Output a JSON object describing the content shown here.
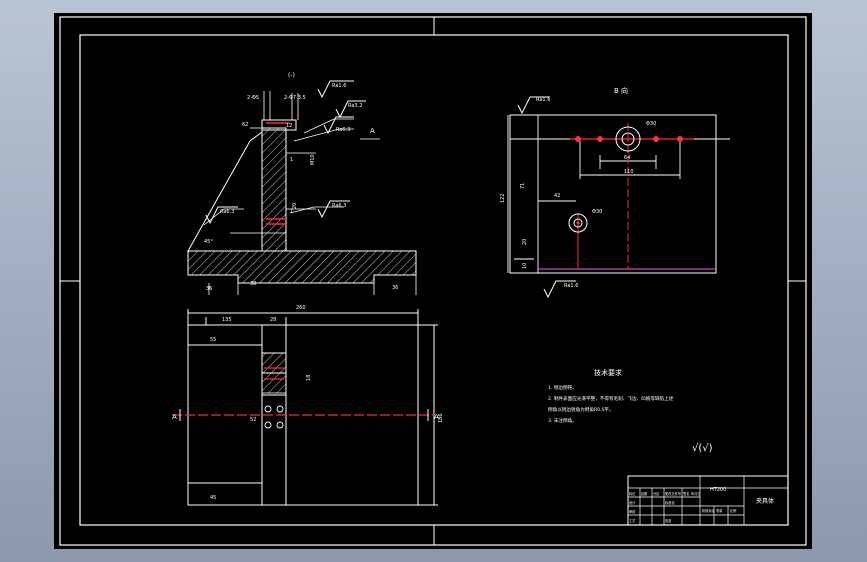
{
  "section_view": {
    "title": "(-)",
    "dims": {
      "left_tab": "2-Φ5",
      "top_chain": "2-Φ7 3.5",
      "h_small": "62",
      "w_small": "12",
      "thread": "M10",
      "dim_1": "1",
      "dim_2": "1",
      "angle": "45°",
      "h_mid": "20",
      "base_left": "36",
      "base_mid": "38",
      "base_right": "36",
      "detail_a": "A"
    },
    "roughness": [
      "Ra1.6",
      "Ra3.2",
      "Ra6.3",
      "Ra6.3",
      "Ra6.3"
    ]
  },
  "top_view": {
    "dims": {
      "overall_w": "260",
      "w1": "135",
      "w2": "28",
      "h1": "55",
      "h2": "45",
      "h_small": "52",
      "h_right": "186",
      "v_small": "18"
    },
    "section_marks": [
      "A",
      "A"
    ]
  },
  "detail_view": {
    "title": "B 向",
    "dims": {
      "left_v": "122",
      "left_v2": "71",
      "inner_v": "20",
      "inner_v2": "10",
      "phi_big": "Φ30",
      "phi_small": "Φ30",
      "span_inner": "64",
      "span_outer": "110",
      "small_off": "42"
    },
    "roughness": [
      "Ra1.6",
      "Ra1.6"
    ]
  },
  "tech_requirements": {
    "title": "技术要求",
    "lines": [
      "1. 锐边倒钝。",
      "2. 制件表面应光滑平整，不得有毛刺、飞边、凹痕等缺陷上述",
      "倒角以锐边锐角为倒角R0.5平。",
      "3. 未注倒角。"
    ]
  },
  "rough_symbol": "√(√)",
  "title_block": {
    "part_name": "HT200",
    "drawing_name": "夹具体",
    "rows": [
      [
        "标记",
        "处数",
        "分区",
        "更改文件号",
        "签名",
        "年月日"
      ],
      [
        "设计",
        "",
        "",
        "标准化",
        "",
        ""
      ],
      [
        "审核",
        "",
        "",
        "",
        "",
        ""
      ],
      [
        "工艺",
        "",
        "",
        "批准",
        "",
        ""
      ]
    ],
    "stage_labels": [
      "阶段标记",
      "重量",
      "比例"
    ]
  }
}
